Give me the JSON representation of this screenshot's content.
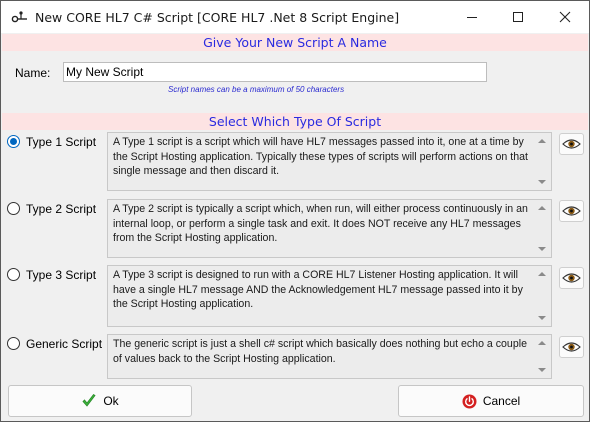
{
  "window": {
    "title": "New CORE HL7 C# Script [CORE HL7 .Net 8 Script Engine]"
  },
  "name_section": {
    "banner": "Give Your New Script A Name",
    "label": "Name:",
    "value": "My New Script",
    "hint": "Script names can be a maximum of 50 characters"
  },
  "type_section": {
    "banner": "Select Which Type Of Script",
    "options": [
      {
        "label": "Type 1 Script",
        "checked": true,
        "description": "A Type 1 script is a script which will have HL7 messages passed into it, one at a time by the Script Hosting application. Typically these types of scripts will perform actions on that single message and then discard it."
      },
      {
        "label": "Type 2 Script",
        "checked": false,
        "description": "A Type 2 script is typically a script which, when run, will either process continuously in an internal loop, or perform a single task and exit. It does NOT receive any HL7 messages from the Script Hosting application."
      },
      {
        "label": "Type 3 Script",
        "checked": false,
        "description": "A Type 3 script is designed to run with a CORE HL7 Listener Hosting application. It will have a single HL7 message AND the Acknowledgement HL7 message passed into it by the Script Hosting application."
      },
      {
        "label": "Generic Script",
        "checked": false,
        "description": "The generic script is just a shell c# script which basically does nothing but echo a couple of values back to the Script Hosting application."
      }
    ]
  },
  "buttons": {
    "ok": "Ok",
    "cancel": "Cancel"
  },
  "icons": {
    "app": "app-connector-icon",
    "minimize": "minimize-icon",
    "maximize": "maximize-icon",
    "close": "close-icon",
    "view": "eye-icon",
    "ok": "checkmark-icon",
    "cancel": "power-icon",
    "scroll_up": "scroll-up-arrow-icon",
    "scroll_down": "scroll-down-arrow-icon"
  },
  "colors": {
    "banner_background": "#fde3e3",
    "banner_text": "#2a2ae0",
    "hint_text": "#2a2ad0",
    "radio_selected": "#0067c0",
    "ok_check": "#3cb43c",
    "cancel_icon": "#d42020"
  }
}
